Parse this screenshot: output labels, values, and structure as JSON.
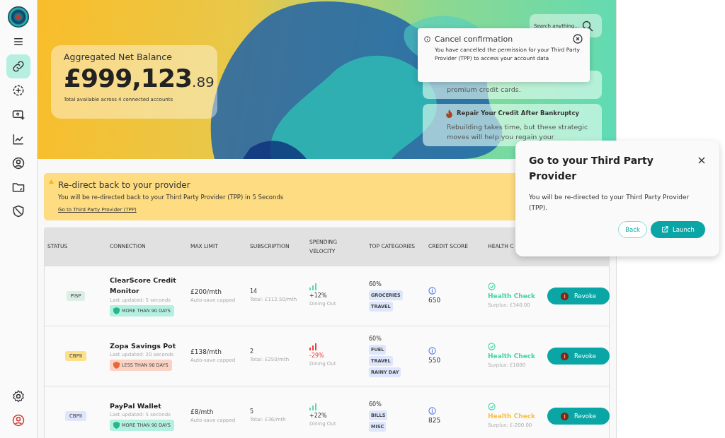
{
  "sidebar": {
    "nav": [
      {
        "selected": true
      },
      {
        "selected": false
      },
      {
        "selected": false
      },
      {
        "selected": false
      },
      {
        "selected": false
      },
      {
        "selected": false
      },
      {
        "selected": false
      }
    ],
    "bottom": [
      {
        "selected": false
      },
      {
        "selected": false
      }
    ]
  },
  "hero": {
    "balance": {
      "title": "Aggregated Net Balance",
      "amount": "£999,123",
      "cents": ".89",
      "caption": "Total available across 4 connected accounts"
    },
    "search": {
      "placeholder": "Search anything..."
    },
    "tips": [
      {
        "body": "premium credit cards."
      },
      {
        "title": "Repair Your Credit After Bankruptcy",
        "body": "Rebuilding takes time, but these strategic moves will help you regain your"
      }
    ]
  },
  "banner": {
    "title": "Re-direct back to your provider",
    "message": "You will be re-directed back to your Third Party Provider (TPP) in 5 Seconds",
    "link": "Go to Third Party Provider (TPP)"
  },
  "table": {
    "columns": [
      "STATUS",
      "CONNECTION",
      "MAX LIMIT",
      "SUBSCRIPTION",
      "SPENDING VELOCITY",
      "TOP CATEGORIES",
      "CREDIT SCORE",
      "HEALTH C"
    ],
    "rows": [
      {
        "status": {
          "label": "PISP",
          "color": "#dcefe6"
        },
        "name": "ClearScore Credit Monitor",
        "updated": "Last updated: 5 seconds",
        "age": {
          "label": "MORE THAN 90 DAYS",
          "color": "#b3f0df"
        },
        "limit": "£200/mth",
        "limit_note": "Auto-save capped",
        "subs": "14",
        "subs_total": "Total: £112.50/mth",
        "velocity": {
          "value": "+12%",
          "negative": false,
          "note": "Dining Out"
        },
        "share": "60%",
        "categories": [
          "GROCERIES",
          "TRAVEL"
        ],
        "score": "650",
        "health": {
          "label": "Health Check",
          "color": "#3ed6a6",
          "note": "Surplus: £340.00"
        },
        "action": "Revoke"
      },
      {
        "status": {
          "label": "CBPII",
          "color": "#fde08a"
        },
        "name": "Zopa Savings Pot",
        "updated": "Last updated: 20 seconds",
        "age": {
          "label": "LESS THAN 90 DAYS",
          "color": "#fbd3c4"
        },
        "limit": "£138/mth",
        "limit_note": "Auto-save capped",
        "subs": "2",
        "subs_total": "Total: £250/mth",
        "velocity": {
          "value": "-29%",
          "negative": true,
          "note": "Dining Out"
        },
        "share": "60%",
        "categories": [
          "FUEL",
          "TRAVEL",
          "RAINY DAY"
        ],
        "score": "550",
        "health": {
          "label": "Health Check",
          "color": "#3ed6a6",
          "note": "Surplus: £1800"
        },
        "action": "Revoke"
      },
      {
        "status": {
          "label": "CBPII",
          "color": "#dfe6fb"
        },
        "name": "PayPal Wallet",
        "updated": "Last updated: 5 seconds",
        "age": {
          "label": "MORE THAN 90 DAYS",
          "color": "#b3f0df"
        },
        "limit": "£8/mth",
        "limit_note": "Auto-save capped",
        "subs": "5",
        "subs_total": "Total: £36/mth",
        "velocity": {
          "value": "+22%",
          "negative": false,
          "note": "Dining Out"
        },
        "share": "60%",
        "categories": [
          "BILLS",
          "MISC"
        ],
        "score": "825",
        "health": {
          "label": "Health Check",
          "color": "#fbbf3a",
          "note": "Surplus: £-200.00"
        },
        "action": "Revoke"
      }
    ]
  },
  "toast": {
    "title": "Cancel confirmation",
    "message": "You have cancelled the permission for your Third Party Provider (TPP) to access your account data"
  },
  "dialog": {
    "title": "Go to your Third Party Provider",
    "message": "You will be re-directed to your Third Party Provider (TPP).",
    "buttons": [
      {
        "label": "Back",
        "kind": "secondary"
      },
      {
        "label": "Launch",
        "kind": "primary"
      }
    ]
  }
}
